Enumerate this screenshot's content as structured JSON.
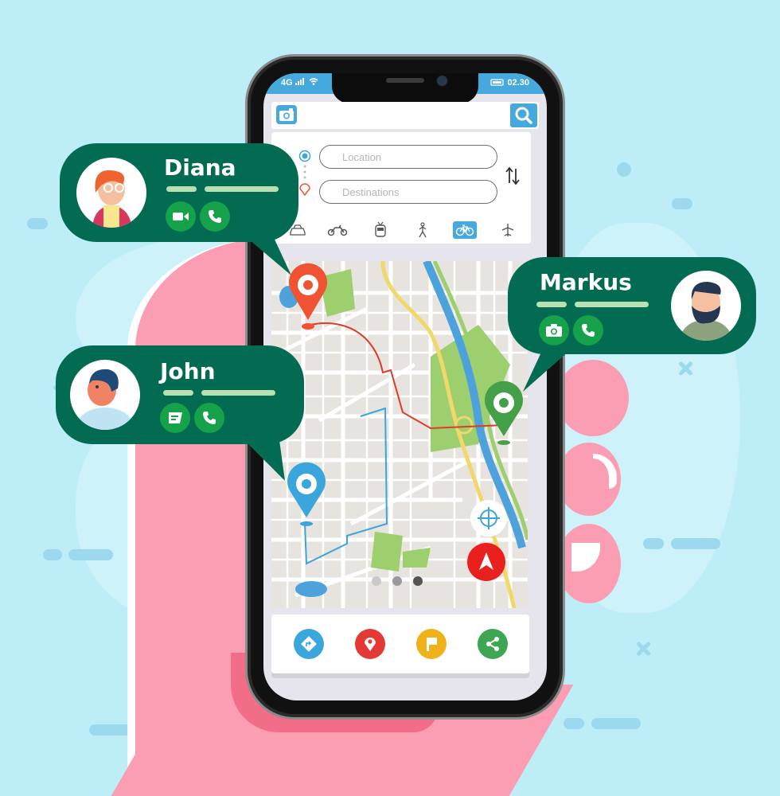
{
  "status_bar": {
    "network": "4G",
    "time": "02.30"
  },
  "search": {
    "placeholder": "",
    "value": ""
  },
  "route": {
    "location_placeholder": "Location",
    "destination_placeholder": "Destinations",
    "swap_icon": "swap-vertical-icon"
  },
  "transport_modes": [
    {
      "name": "car",
      "icon": "car-icon",
      "active": false
    },
    {
      "name": "motorbike",
      "icon": "motorbike-icon",
      "active": false
    },
    {
      "name": "train",
      "icon": "train-icon",
      "active": false
    },
    {
      "name": "walk",
      "icon": "walk-icon",
      "active": false
    },
    {
      "name": "bicycle",
      "icon": "bicycle-icon",
      "active": true
    },
    {
      "name": "plane",
      "icon": "plane-icon",
      "active": false
    }
  ],
  "map": {
    "pins": [
      {
        "color": "#f05332",
        "name": "red-pin"
      },
      {
        "color": "#43a047",
        "name": "green-pin"
      },
      {
        "color": "#3aa6dc",
        "name": "blue-pin"
      }
    ],
    "page_dots": 3,
    "active_dot": 3
  },
  "actions": [
    {
      "name": "directions",
      "icon": "directions-icon",
      "color": "#3aa6dc"
    },
    {
      "name": "location",
      "icon": "location-pin-icon",
      "color": "#e53935"
    },
    {
      "name": "flag",
      "icon": "flag-icon",
      "color": "#f0b21a"
    },
    {
      "name": "share",
      "icon": "share-icon",
      "color": "#3ea552"
    }
  ],
  "contacts": [
    {
      "name": "Diana",
      "buttons": [
        "video-call-icon",
        "phone-icon"
      ]
    },
    {
      "name": "Markus",
      "buttons": [
        "camera-icon",
        "phone-icon"
      ]
    },
    {
      "name": "John",
      "buttons": [
        "message-icon",
        "phone-icon"
      ]
    }
  ],
  "colors": {
    "background": "#bdeef8",
    "bubble": "#046b53",
    "button_green": "#16a14b",
    "accent_blue": "#45a9de",
    "hand": "#fb9db3"
  }
}
